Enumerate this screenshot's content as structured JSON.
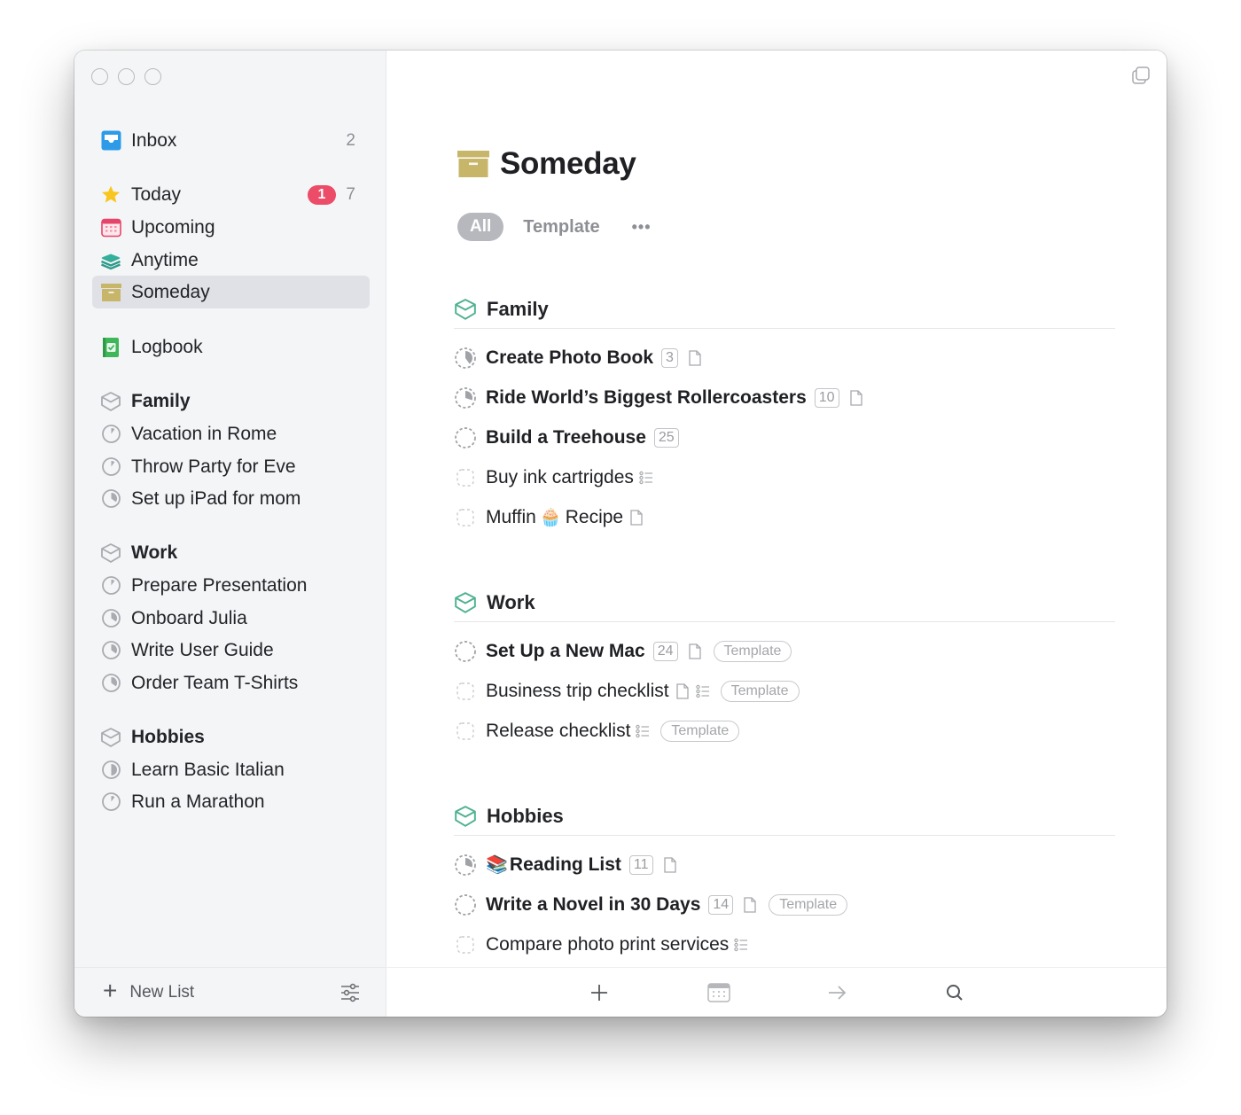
{
  "window": {
    "traffic_lights": [
      "close",
      "minimize",
      "zoom"
    ],
    "copy_icon": "duplicate-window-icon"
  },
  "sidebar": {
    "inbox": {
      "label": "Inbox",
      "count": "2",
      "icon": "inbox-tray-icon"
    },
    "smart_lists": [
      {
        "label": "Today",
        "badge": "1",
        "count": "7",
        "icon": "star-icon"
      },
      {
        "label": "Upcoming",
        "icon": "calendar-icon"
      },
      {
        "label": "Anytime",
        "icon": "layers-icon"
      },
      {
        "label": "Someday",
        "icon": "archive-box-icon",
        "active": true
      }
    ],
    "logbook": {
      "label": "Logbook",
      "icon": "logbook-check-icon"
    },
    "areas": [
      {
        "label": "Family",
        "projects": [
          "Vacation in Rome",
          "Throw Party for Eve",
          "Set up iPad for mom"
        ]
      },
      {
        "label": "Work",
        "projects": [
          "Prepare Presentation",
          "Onboard Julia",
          "Write User Guide",
          "Order Team T-Shirts"
        ]
      },
      {
        "label": "Hobbies",
        "projects": [
          "Learn Basic Italian",
          "Run a Marathon"
        ]
      }
    ],
    "project_progress": {
      "Vacation in Rome": 0.1,
      "Throw Party for Eve": 0.1,
      "Set up iPad for mom": 0.35,
      "Prepare Presentation": 0.1,
      "Onboard Julia": 0.35,
      "Write User Guide": 0.35,
      "Order Team T-Shirts": 0.35,
      "Learn Basic Italian": 0.5,
      "Run a Marathon": 0.1
    },
    "footer": {
      "new_list_label": "New List",
      "plus": "+",
      "filter_icon": "sliders-icon"
    }
  },
  "main": {
    "title": "Someday",
    "filters": {
      "all": "All",
      "template": "Template",
      "more": "•••"
    },
    "sections": [
      {
        "title": "Family",
        "tasks": [
          {
            "name": "Create Photo Book",
            "bold": true,
            "count": "3",
            "note": true,
            "checklist": false,
            "template": false,
            "progress": 0.4
          },
          {
            "name": "Ride World’s Biggest Rollercoasters",
            "bold": true,
            "count": "10",
            "note": true,
            "checklist": false,
            "template": false,
            "progress": 0.3
          },
          {
            "name": "Build a Treehouse",
            "bold": true,
            "count": "25",
            "note": false,
            "checklist": false,
            "template": false,
            "progress": 0
          },
          {
            "name": "Buy ink cartrigdes",
            "bold": false,
            "count": "",
            "note": false,
            "checklist": true,
            "template": false
          },
          {
            "name": "Muffin",
            "emoji": "🧁",
            "name_after": "Recipe",
            "bold": false,
            "count": "",
            "note": true,
            "checklist": false,
            "template": false
          }
        ]
      },
      {
        "title": "Work",
        "tasks": [
          {
            "name": "Set Up a New Mac",
            "bold": true,
            "count": "24",
            "note": true,
            "checklist": false,
            "template": true,
            "progress": 0
          },
          {
            "name": "Business trip checklist",
            "bold": false,
            "count": "",
            "note": true,
            "checklist": true,
            "template": true
          },
          {
            "name": "Release checklist",
            "bold": false,
            "count": "",
            "note": false,
            "checklist": true,
            "template": true
          }
        ]
      },
      {
        "title": "Hobbies",
        "tasks": [
          {
            "name": "Reading List",
            "emoji_before": "📚",
            "bold": true,
            "count": "11",
            "note": true,
            "checklist": false,
            "template": false,
            "progress": 0.3
          },
          {
            "name": "Write a Novel in 30 Days",
            "bold": true,
            "count": "14",
            "note": true,
            "checklist": false,
            "template": true,
            "progress": 0
          },
          {
            "name": "Compare photo print services",
            "bold": false,
            "count": "",
            "note": false,
            "checklist": true,
            "template": false
          }
        ]
      }
    ],
    "template_tag": "Template",
    "toolbar": [
      {
        "name": "new-todo",
        "icon": "plus-icon"
      },
      {
        "name": "when",
        "icon": "calendar-icon"
      },
      {
        "name": "move",
        "icon": "arrow-right-icon"
      },
      {
        "name": "search",
        "icon": "search-icon"
      }
    ]
  },
  "colors": {
    "accent_teal": "#4fb28f",
    "someday_box": "#c7b56a",
    "badge_red": "#ec4c67",
    "inbox_blue": "#2e9be8",
    "upcoming_red": "#e6456a",
    "logbook_green": "#3fb65a",
    "star_yellow": "#f8c61e"
  }
}
